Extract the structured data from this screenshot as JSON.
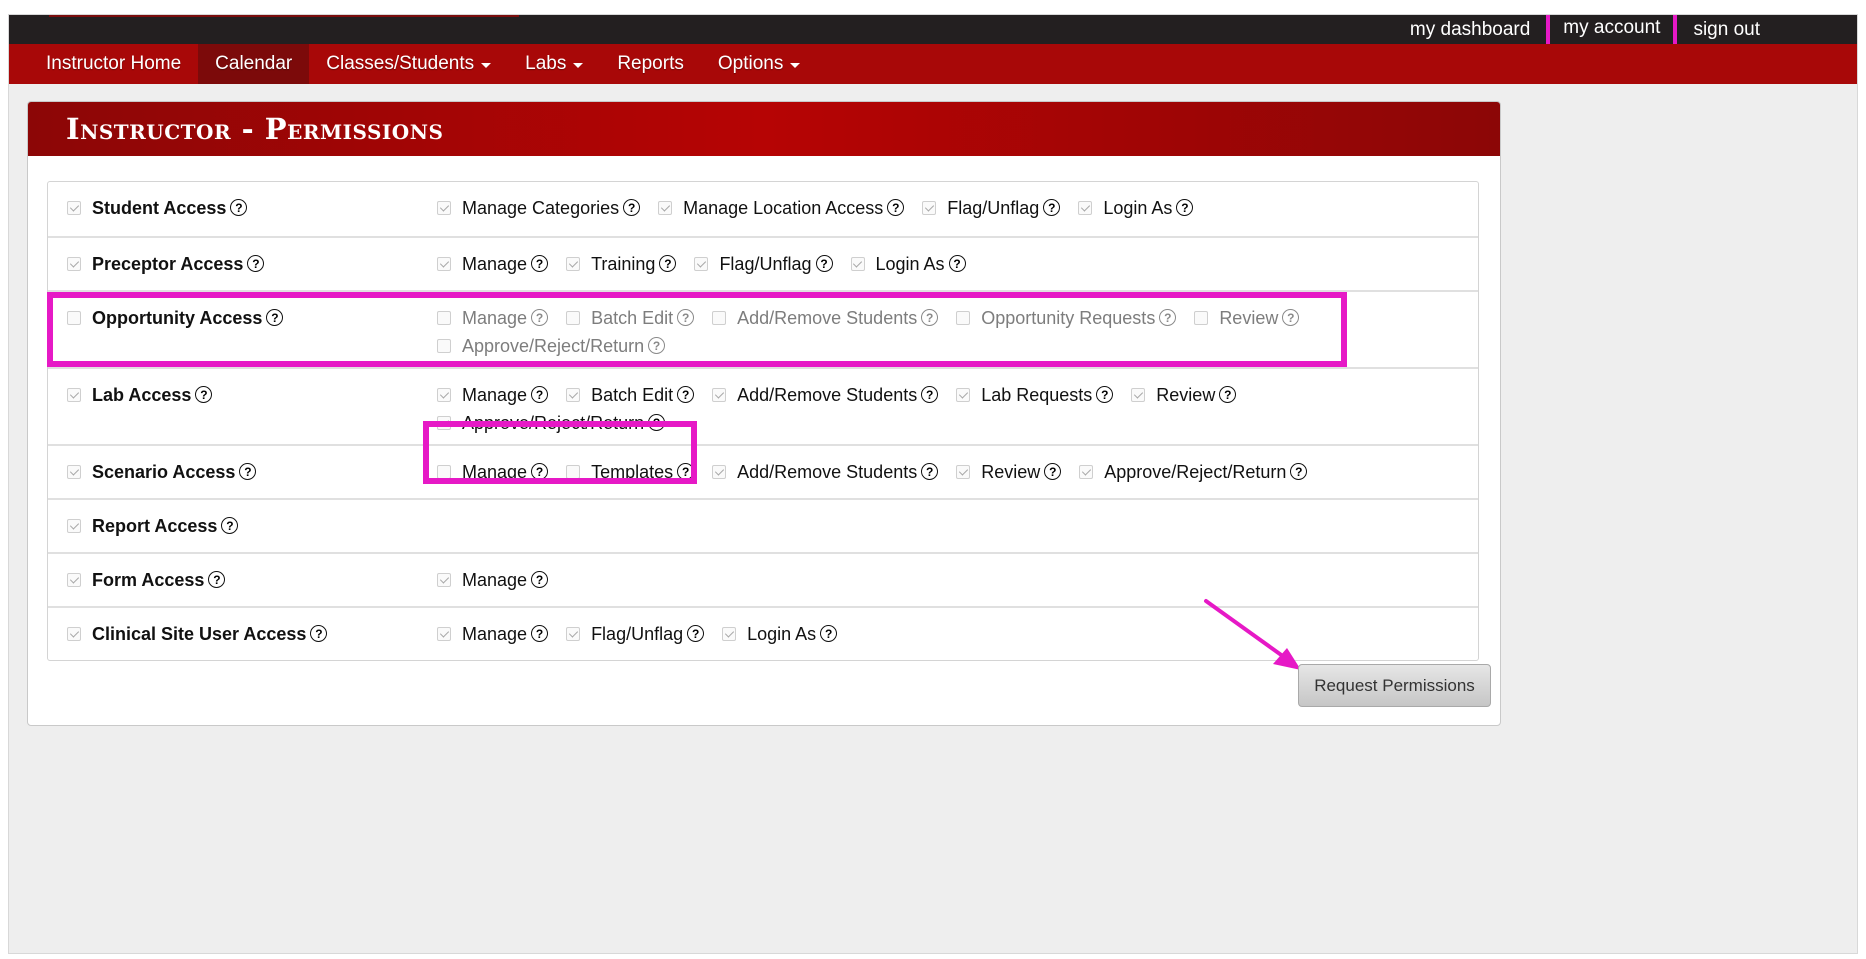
{
  "topbar": {
    "links": [
      "my dashboard",
      "my account",
      "sign out"
    ]
  },
  "nav": {
    "items": [
      {
        "label": "Instructor Home",
        "dropdown": false,
        "active": false
      },
      {
        "label": "Calendar",
        "dropdown": false,
        "active": true
      },
      {
        "label": "Classes/Students",
        "dropdown": true,
        "active": false
      },
      {
        "label": "Labs",
        "dropdown": true,
        "active": false
      },
      {
        "label": "Reports",
        "dropdown": false,
        "active": false
      },
      {
        "label": "Options",
        "dropdown": true,
        "active": false
      }
    ]
  },
  "panel": {
    "title": "Instructor - Permissions"
  },
  "permissions": [
    {
      "label": "Student Access",
      "checked": true,
      "options": [
        {
          "label": "Manage Categories",
          "checked": true
        },
        {
          "label": "Manage Location Access",
          "checked": true
        },
        {
          "label": "Flag/Unflag",
          "checked": true
        },
        {
          "label": "Login As",
          "checked": true
        }
      ]
    },
    {
      "label": "Preceptor Access",
      "checked": true,
      "options": [
        {
          "label": "Manage",
          "checked": true
        },
        {
          "label": "Training",
          "checked": true
        },
        {
          "label": "Flag/Unflag",
          "checked": true
        },
        {
          "label": "Login As",
          "checked": true
        }
      ]
    },
    {
      "label": "Opportunity Access",
      "checked": false,
      "options": [
        {
          "label": "Manage",
          "checked": false
        },
        {
          "label": "Batch Edit",
          "checked": false
        },
        {
          "label": "Add/Remove Students",
          "checked": false
        },
        {
          "label": "Opportunity Requests",
          "checked": false
        },
        {
          "label": "Review",
          "checked": false
        },
        {
          "label": "Approve/Reject/Return",
          "checked": false
        }
      ]
    },
    {
      "label": "Lab Access",
      "checked": true,
      "options": [
        {
          "label": "Manage",
          "checked": true
        },
        {
          "label": "Batch Edit",
          "checked": true
        },
        {
          "label": "Add/Remove Students",
          "checked": true
        },
        {
          "label": "Lab Requests",
          "checked": true
        },
        {
          "label": "Review",
          "checked": true
        },
        {
          "label": "Approve/Reject/Return",
          "checked": true
        }
      ]
    },
    {
      "label": "Scenario Access",
      "checked": true,
      "options": [
        {
          "label": "Manage",
          "checked": false
        },
        {
          "label": "Templates",
          "checked": false
        },
        {
          "label": "Add/Remove Students",
          "checked": true
        },
        {
          "label": "Review",
          "checked": true
        },
        {
          "label": "Approve/Reject/Return",
          "checked": true
        }
      ]
    },
    {
      "label": "Report Access",
      "checked": true,
      "options": []
    },
    {
      "label": "Form Access",
      "checked": true,
      "options": [
        {
          "label": "Manage",
          "checked": true
        }
      ]
    },
    {
      "label": "Clinical Site User Access",
      "checked": true,
      "options": [
        {
          "label": "Manage",
          "checked": true
        },
        {
          "label": "Flag/Unflag",
          "checked": true
        },
        {
          "label": "Login As",
          "checked": true
        }
      ]
    }
  ],
  "request_button": "Request Permissions",
  "colors": {
    "topbar": "#231f20",
    "navbar": "#a80808",
    "nav_active": "#7c0a0a",
    "highlight": "#e619c6"
  }
}
